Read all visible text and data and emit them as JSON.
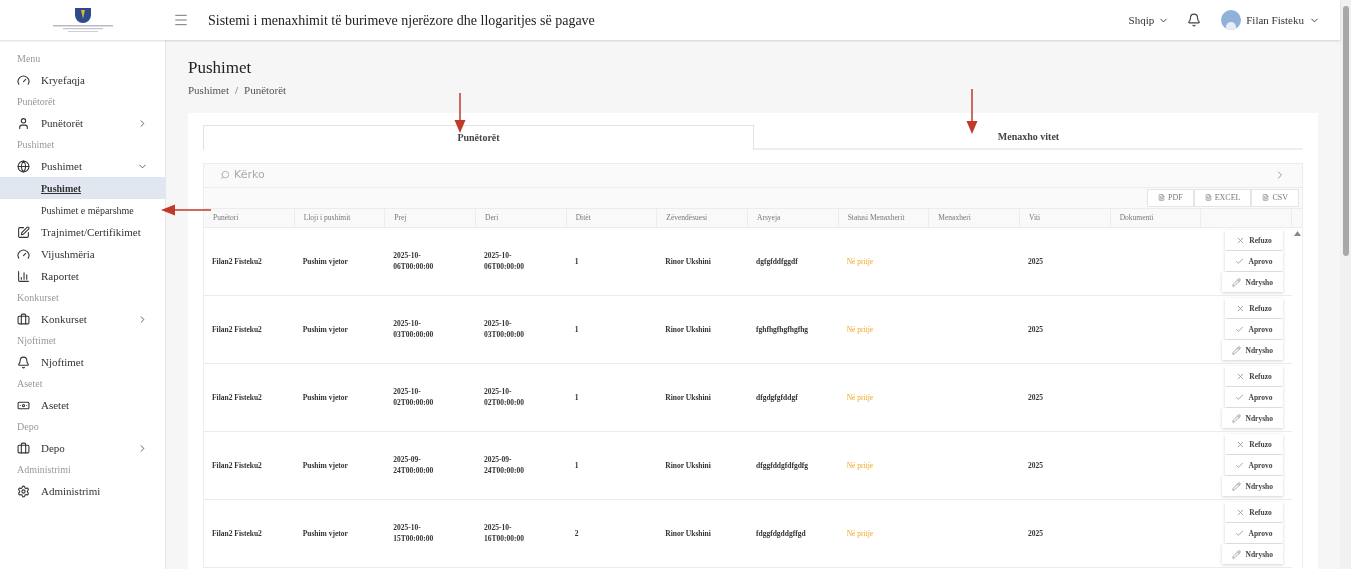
{
  "header": {
    "title": "Sistemi i menaxhimit të burimeve njerëzore dhe llogaritjes së pagave",
    "language": "Shqip",
    "user": "Filan Fisteku"
  },
  "sidebar": [
    {
      "kind": "section",
      "label": "Menu"
    },
    {
      "kind": "item",
      "label": "Kryefaqja"
    },
    {
      "kind": "section",
      "label": "Punëtorët"
    },
    {
      "kind": "item",
      "label": "Punëtorët",
      "expanded": false
    },
    {
      "kind": "section",
      "label": "Pushimet"
    },
    {
      "kind": "item",
      "label": "Pushimet",
      "expanded": true,
      "children": [
        {
          "label": "Pushimet",
          "selected": true
        },
        {
          "label": "Pushimet e mëparshme",
          "selected": false
        }
      ]
    },
    {
      "kind": "item",
      "label": "Trajnimet/Certifikimet"
    },
    {
      "kind": "item",
      "label": "Vijushmëria"
    },
    {
      "kind": "item",
      "label": "Raportet"
    },
    {
      "kind": "section",
      "label": "Konkurset"
    },
    {
      "kind": "item",
      "label": "Konkurset",
      "expanded": false
    },
    {
      "kind": "section",
      "label": "Njoftimet"
    },
    {
      "kind": "item",
      "label": "Njoftimet"
    },
    {
      "kind": "section",
      "label": "Asetet"
    },
    {
      "kind": "item",
      "label": "Asetet"
    },
    {
      "kind": "section",
      "label": "Depo"
    },
    {
      "kind": "item",
      "label": "Depo",
      "expanded": false
    },
    {
      "kind": "section",
      "label": "Administrimi"
    },
    {
      "kind": "item",
      "label": "Administrimi"
    }
  ],
  "page": {
    "title": "Pushimet",
    "breadcrumb": {
      "items": [
        "Pushimet",
        "Punëtorët"
      ],
      "separator": "/"
    }
  },
  "tabs": [
    {
      "label": "Punëtorët",
      "selected": true
    },
    {
      "label": "Menaxho vitet",
      "selected": false
    }
  ],
  "search": {
    "placeholder": "Kërko"
  },
  "exports": [
    "PDF",
    "EXCEL",
    "CSV"
  ],
  "table": {
    "columns": [
      "Punëtori",
      "Lloji i pushimit",
      "Prej",
      "Deri",
      "Ditët",
      "Zëvendësuesi",
      "Arsyeja",
      "Statusi Menaxherit",
      "Menaxheri",
      "Viti",
      "Dokumenti"
    ],
    "rows": [
      {
        "cells": [
          "Filan2 Fisteku2",
          "Pushim vjetor",
          "2025-10-06T00:00:00",
          "2025-10-06T00:00:00",
          "1",
          "Rinor Ukshini",
          "dgfgfddfggdf",
          "Në pritje",
          "",
          "2025",
          ""
        ],
        "actions": [
          "Refuzo",
          "Aprovo",
          "Ndrysho"
        ]
      },
      {
        "cells": [
          "Filan2 Fisteku2",
          "Pushim vjetor",
          "2025-10-03T00:00:00",
          "2025-10-03T00:00:00",
          "1",
          "Rinor Ukshini",
          "fghfhgfhgfhgfhg",
          "Në pritje",
          "",
          "2025",
          ""
        ],
        "actions": [
          "Refuzo",
          "Aprovo",
          "Ndrysho"
        ]
      },
      {
        "cells": [
          "Filan2 Fisteku2",
          "Pushim vjetor",
          "2025-10-02T00:00:00",
          "2025-10-02T00:00:00",
          "1",
          "Rinor Ukshini",
          "dfgdgfgfddgf",
          "Në pritje",
          "",
          "2025",
          ""
        ],
        "actions": [
          "Refuzo",
          "Aprovo",
          "Ndrysho"
        ]
      },
      {
        "cells": [
          "Filan2 Fisteku2",
          "Pushim vjetor",
          "2025-09-24T00:00:00",
          "2025-09-24T00:00:00",
          "1",
          "Rinor Ukshini",
          "dfggfddgfdfgdfg",
          "Në pritje",
          "",
          "2025",
          ""
        ],
        "actions": [
          "Refuzo",
          "Aprovo",
          "Ndrysho"
        ]
      },
      {
        "cells": [
          "Filan2 Fisteku2",
          "Pushim vjetor",
          "2025-10-15T00:00:00",
          "2025-10-16T00:00:00",
          "2",
          "Rinor Ukshini",
          "fdggfdgddgffgd",
          "Në pritje",
          "",
          "2025",
          ""
        ],
        "actions": [
          "Refuzo",
          "Aprovo",
          "Ndrysho"
        ]
      }
    ]
  }
}
